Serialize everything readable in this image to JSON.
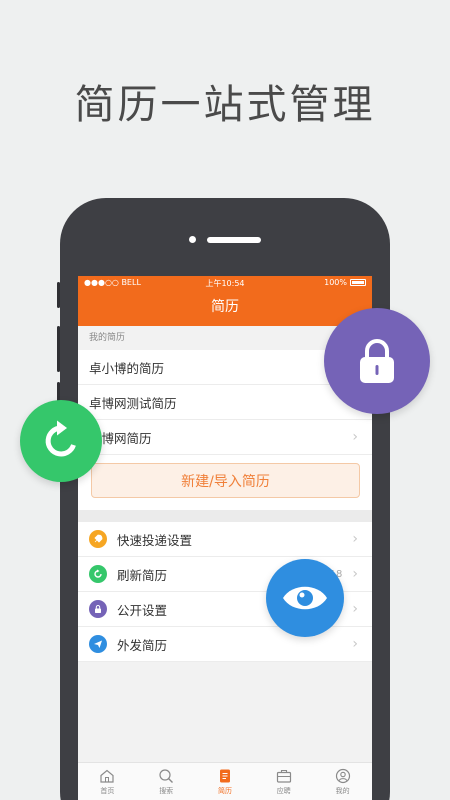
{
  "headline": "简历一站式管理",
  "status": {
    "carrier": "●●●○○ BELL",
    "time": "上午10:54",
    "battery": "100%"
  },
  "nav": {
    "title": "简历"
  },
  "resumes": {
    "section_label": "我的简历",
    "items": [
      {
        "name": "卓小博的简历"
      },
      {
        "name": "卓博网测试简历"
      },
      {
        "name": "卓博网简历"
      }
    ],
    "new_button": "新建/导入简历"
  },
  "menu": [
    {
      "label": "快速投递设置",
      "icon": "rocket-icon",
      "color": "#f6a623"
    },
    {
      "label": "刷新简历",
      "icon": "refresh-icon",
      "color": "#35c76b",
      "date": "2016-03-18"
    },
    {
      "label": "公开设置",
      "icon": "lock-icon",
      "color": "#7563b7"
    },
    {
      "label": "外发简历",
      "icon": "send-icon",
      "color": "#2f8ee0"
    }
  ],
  "tabs": [
    {
      "label": "首页",
      "icon": "home-icon"
    },
    {
      "label": "搜索",
      "icon": "search-icon"
    },
    {
      "label": "简历",
      "icon": "resume-icon",
      "active": true
    },
    {
      "label": "应聘",
      "icon": "briefcase-icon"
    },
    {
      "label": "我的",
      "icon": "user-icon"
    }
  ],
  "colors": {
    "brand": "#f26b1c",
    "lock": "#7563b7",
    "refresh": "#35c76b",
    "eye": "#2f8ee0"
  }
}
